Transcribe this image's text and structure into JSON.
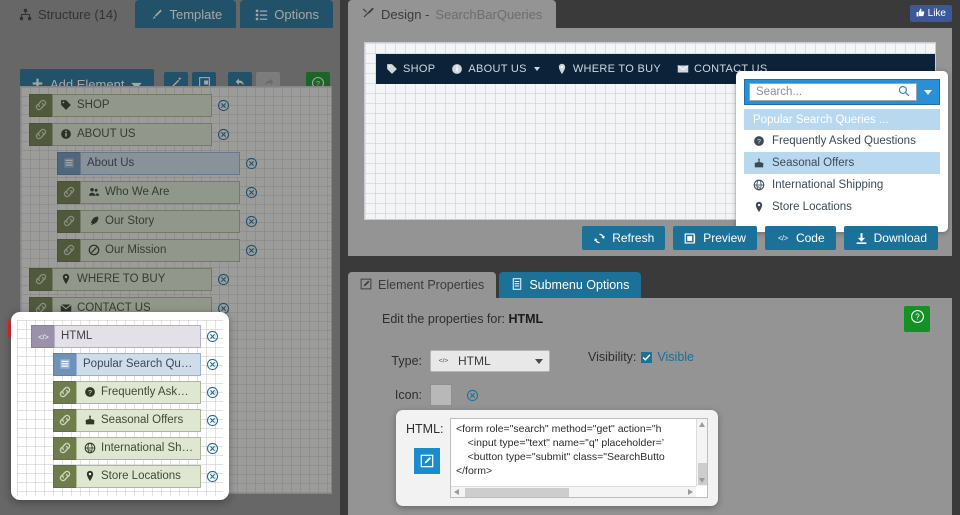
{
  "left_panel": {
    "tabs": [
      {
        "label": "Structure (14)",
        "icon": "sitemap-icon",
        "active": true
      },
      {
        "label": "Template",
        "icon": "brush-icon",
        "active": false
      },
      {
        "label": "Options",
        "icon": "list-icon",
        "active": false
      }
    ],
    "toolbar": {
      "add_element_label": "Add Element",
      "buttons": [
        {
          "name": "magic-wand-button",
          "icon": "magic-wand-icon"
        },
        {
          "name": "duplicate-button",
          "icon": "duplicate-icon"
        },
        {
          "name": "undo-button",
          "icon": "undo-arrow-icon"
        },
        {
          "name": "redo-button",
          "icon": "redo-arrow-icon",
          "disabled": true
        },
        {
          "name": "help-button",
          "icon": "question-circle-icon"
        }
      ]
    },
    "tree": [
      {
        "label": "SHOP",
        "depth": 1,
        "glyph": "tag-icon",
        "handle": "link-icon",
        "kind": "link"
      },
      {
        "label": "ABOUT US",
        "depth": 1,
        "glyph": "info-circle-icon",
        "handle": "link-icon",
        "kind": "link"
      },
      {
        "label": "About Us",
        "depth": 2,
        "glyph": "",
        "handle": "menu-icon",
        "kind": "menu"
      },
      {
        "label": "Who We Are",
        "depth": 2,
        "glyph": "users-icon",
        "handle": "link-icon",
        "kind": "link"
      },
      {
        "label": "Our Story",
        "depth": 2,
        "glyph": "feather-icon",
        "handle": "link-icon",
        "kind": "link"
      },
      {
        "label": "Our Mission",
        "depth": 2,
        "glyph": "target-icon",
        "handle": "link-icon",
        "kind": "link"
      },
      {
        "label": "WHERE TO BUY",
        "depth": 1,
        "glyph": "map-pin-icon",
        "handle": "link-icon",
        "kind": "link"
      },
      {
        "label": "CONTACT US",
        "depth": 1,
        "glyph": "envelope-icon",
        "handle": "link-icon",
        "kind": "link"
      }
    ],
    "popout_tree": [
      {
        "label": "HTML",
        "depth": 1,
        "glyph": "",
        "handle": "code-icon",
        "kind": "html"
      },
      {
        "label": "Popular Search Queries ...",
        "depth": 2,
        "glyph": "",
        "handle": "menu-icon",
        "kind": "menu"
      },
      {
        "label": "Frequently Asked Questio...",
        "depth": 2,
        "glyph": "question-circle-icon",
        "handle": "link-icon",
        "kind": "link"
      },
      {
        "label": "Seasonal Offers",
        "depth": 2,
        "glyph": "gift-icon",
        "handle": "link-icon",
        "kind": "link"
      },
      {
        "label": "International Shipping",
        "depth": 2,
        "glyph": "globe-icon",
        "handle": "link-icon",
        "kind": "link"
      },
      {
        "label": "Store Locations",
        "depth": 2,
        "glyph": "map-pin-icon",
        "handle": "link-icon",
        "kind": "link"
      }
    ]
  },
  "design": {
    "tab_title": "Design - ",
    "tab_subtitle": "SearchBarQueries",
    "like_label": "Like",
    "nav_items": [
      {
        "label": "SHOP",
        "icon": "tag-icon",
        "caret": false
      },
      {
        "label": "ABOUT US",
        "icon": "info-circle-icon",
        "caret": true
      },
      {
        "label": "WHERE TO BUY",
        "icon": "map-pin-icon",
        "caret": false
      },
      {
        "label": "CONTACT US",
        "icon": "envelope-icon",
        "caret": false
      }
    ],
    "search": {
      "placeholder": "Search...",
      "icon": "search-icon",
      "caret_icon": "chevron-down-icon"
    },
    "dropdown": [
      {
        "label": "Popular Search Queries ...",
        "icon": "",
        "state": "header"
      },
      {
        "label": "Frequently Asked Questions",
        "icon": "question-circle-icon",
        "state": "normal"
      },
      {
        "label": "Seasonal Offers",
        "icon": "gift-icon",
        "state": "selected"
      },
      {
        "label": "International Shipping",
        "icon": "globe-icon",
        "state": "normal"
      },
      {
        "label": "Store Locations",
        "icon": "map-pin-icon",
        "state": "normal"
      }
    ],
    "actions": [
      {
        "label": "Refresh",
        "icon": "refresh-icon"
      },
      {
        "label": "Preview",
        "icon": "preview-icon"
      },
      {
        "label": "Code",
        "icon": "code-icon"
      },
      {
        "label": "Download",
        "icon": "download-icon"
      }
    ]
  },
  "properties": {
    "tabs": [
      {
        "label": "Element Properties",
        "icon": "edit-square-icon",
        "active": true
      },
      {
        "label": "Submenu Options",
        "icon": "list-doc-icon",
        "active": false
      }
    ],
    "edit_for_prefix": "Edit the properties for: ",
    "edit_for_target": "HTML",
    "type_label": "Type:",
    "type_value": "HTML",
    "type_icon": "code-icon",
    "visibility_label": "Visibility:",
    "visibility_value": "Visible",
    "visibility_checked": "✔",
    "icon_label": "Icon:",
    "icon_clear": "clear-icon",
    "html_label": "HTML:",
    "html_code": "<form role=\"search\" method=\"get\" action=\"h\n    <input type=\"text\" name=\"q\" placeholder=’\n    <button type=\"submit\" class=\"SearchButto\n</form>",
    "help_icon": "question-circle-icon"
  },
  "colors": {
    "accent_blue": "#1c7199",
    "green": "#159025",
    "navbar_dark": "#0b2239",
    "panel_gray": "#949494",
    "tree_green": "#dfe7d2",
    "tree_blue": "#cfdcea",
    "dropdown_highlight": "#b8d8ef",
    "like_blue": "#3b5998",
    "marker_red": "#e8252a"
  }
}
